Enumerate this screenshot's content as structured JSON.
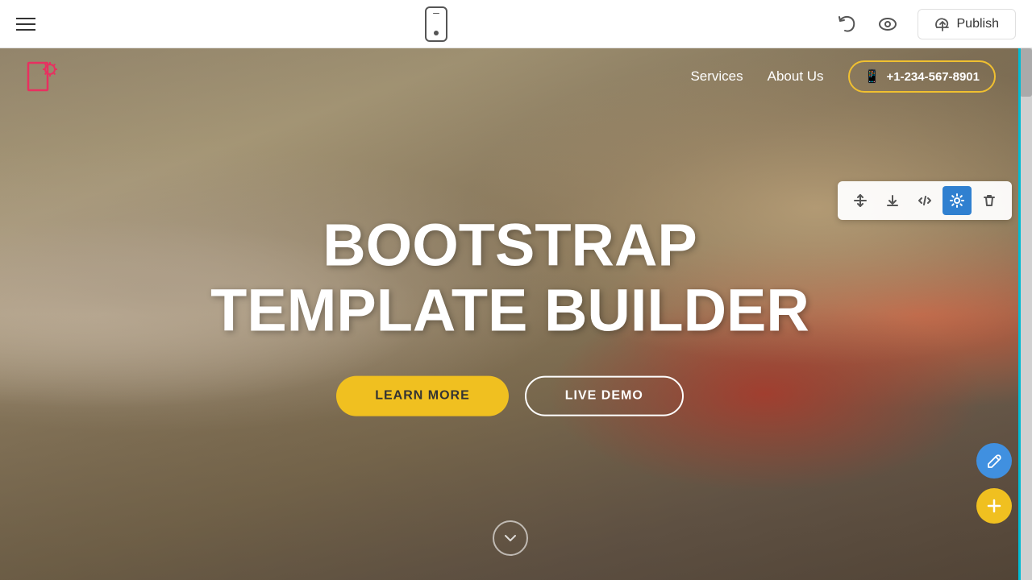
{
  "toolbar": {
    "publish_label": "Publish",
    "hamburger_label": "Menu"
  },
  "site": {
    "navbar": {
      "nav_links": [
        {
          "label": "Services",
          "id": "services"
        },
        {
          "label": "About Us",
          "id": "about-us"
        }
      ],
      "phone": "+1-234-567-8901"
    },
    "hero": {
      "title_line1": "BOOTSTRAP",
      "title_line2": "TEMPLATE BUILDER",
      "btn_learn_more": "LEARN MORE",
      "btn_live_demo": "LIVE DEMO"
    }
  },
  "block_toolbar": {
    "move_icon": "↕",
    "download_icon": "↓",
    "code_icon": "</>",
    "settings_icon": "⚙",
    "delete_icon": "🗑"
  },
  "fabs": {
    "edit_icon": "✏",
    "add_icon": "+"
  }
}
